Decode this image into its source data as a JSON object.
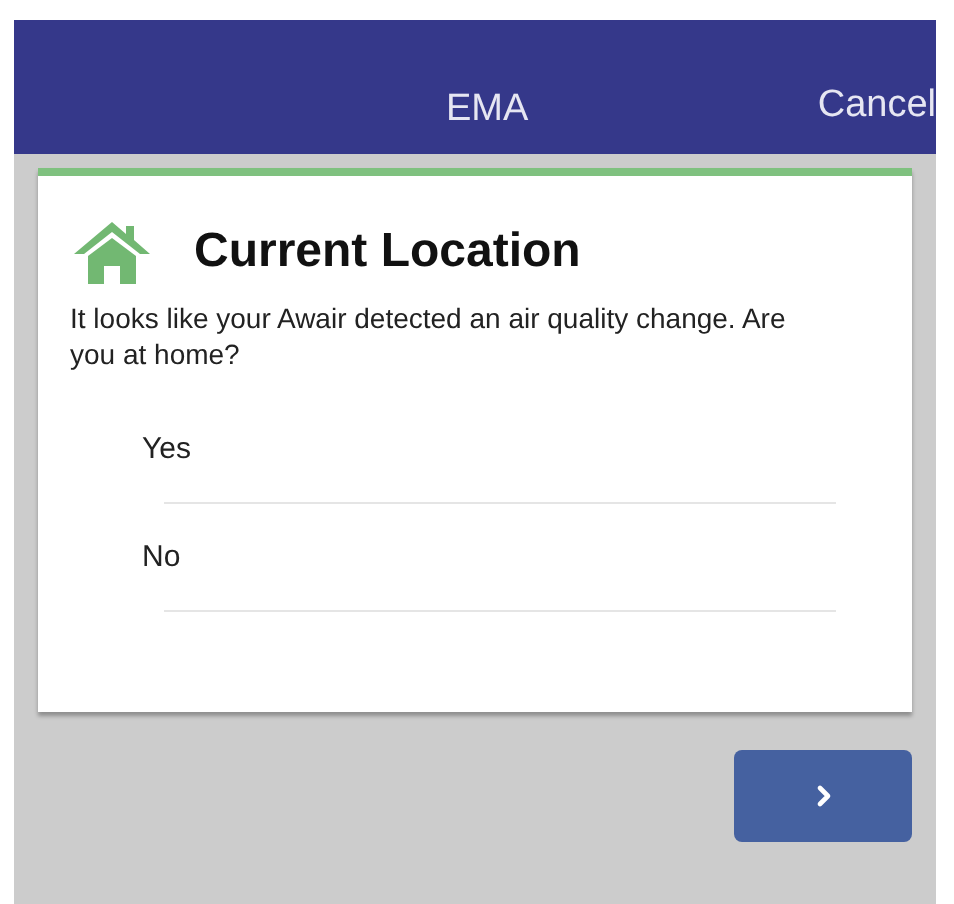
{
  "header": {
    "title": "EMA",
    "cancel": "Cancel"
  },
  "card": {
    "title": "Current Location",
    "question": "It looks like your Awair detected an air quality change. Are you at home?",
    "options": [
      "Yes",
      "No"
    ]
  }
}
